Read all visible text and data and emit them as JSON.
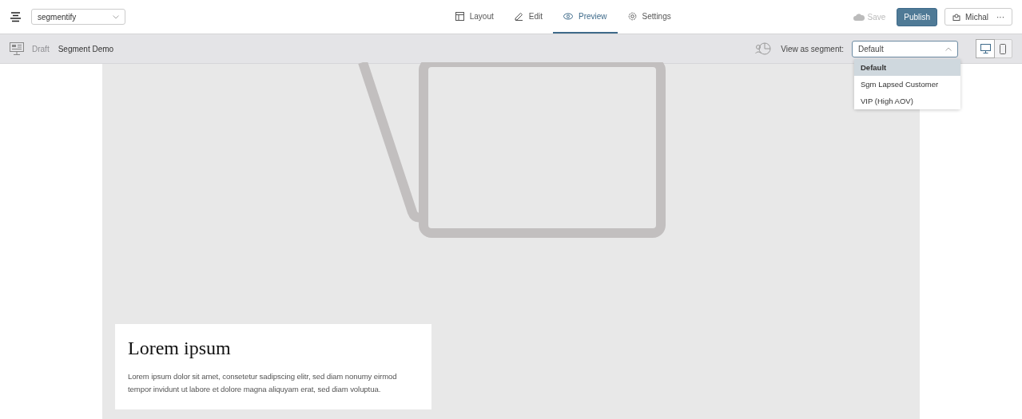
{
  "header": {
    "site_select": {
      "value": "segmentify"
    },
    "tabs": [
      {
        "label": "Layout",
        "kind": "layout",
        "selected": false
      },
      {
        "label": "Edit",
        "kind": "edit",
        "selected": false
      },
      {
        "label": "Preview",
        "kind": "preview",
        "selected": true
      },
      {
        "label": "Settings",
        "kind": "settings",
        "selected": false
      }
    ],
    "save": {
      "label": "Save",
      "disabled": true
    },
    "publish": {
      "label": "Publish"
    },
    "user": {
      "name": "Michal",
      "more": "···"
    }
  },
  "subbar": {
    "status": "Draft",
    "page_title": "Segment Demo",
    "segment_label": "View as segment:",
    "segment_select": {
      "value": "Default",
      "expanded": true
    },
    "segment_options": [
      {
        "label": "Default",
        "selected": true
      },
      {
        "label": "Sgm Lapsed Customer",
        "selected": false
      },
      {
        "label": "VIP (High AOV)",
        "selected": false
      }
    ],
    "devices": [
      {
        "kind": "desktop",
        "selected": true
      },
      {
        "kind": "mobile",
        "selected": false
      }
    ]
  },
  "canvas": {
    "card": {
      "title": "Lorem ipsum",
      "body": "Lorem ipsum dolor sit amet, consetetur sadipscing elitr, sed diam nonumy eirmod tempor invidunt ut labore et dolore magna aliquyam erat, sed diam voluptua."
    }
  }
}
